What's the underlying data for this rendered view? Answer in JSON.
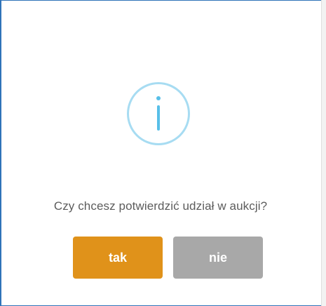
{
  "dialog": {
    "icon": "info-icon",
    "question": "Czy chcesz potwierdzić udział w aukcji?",
    "confirm_label": "tak",
    "cancel_label": "nie"
  },
  "colors": {
    "frame_border": "#2f73b9",
    "icon_ring": "#a7dcf2",
    "icon_glyph": "#58bfe8",
    "confirm_bg": "#e0921a",
    "cancel_bg": "#a8a8a8",
    "text": "#5c5c5c"
  }
}
